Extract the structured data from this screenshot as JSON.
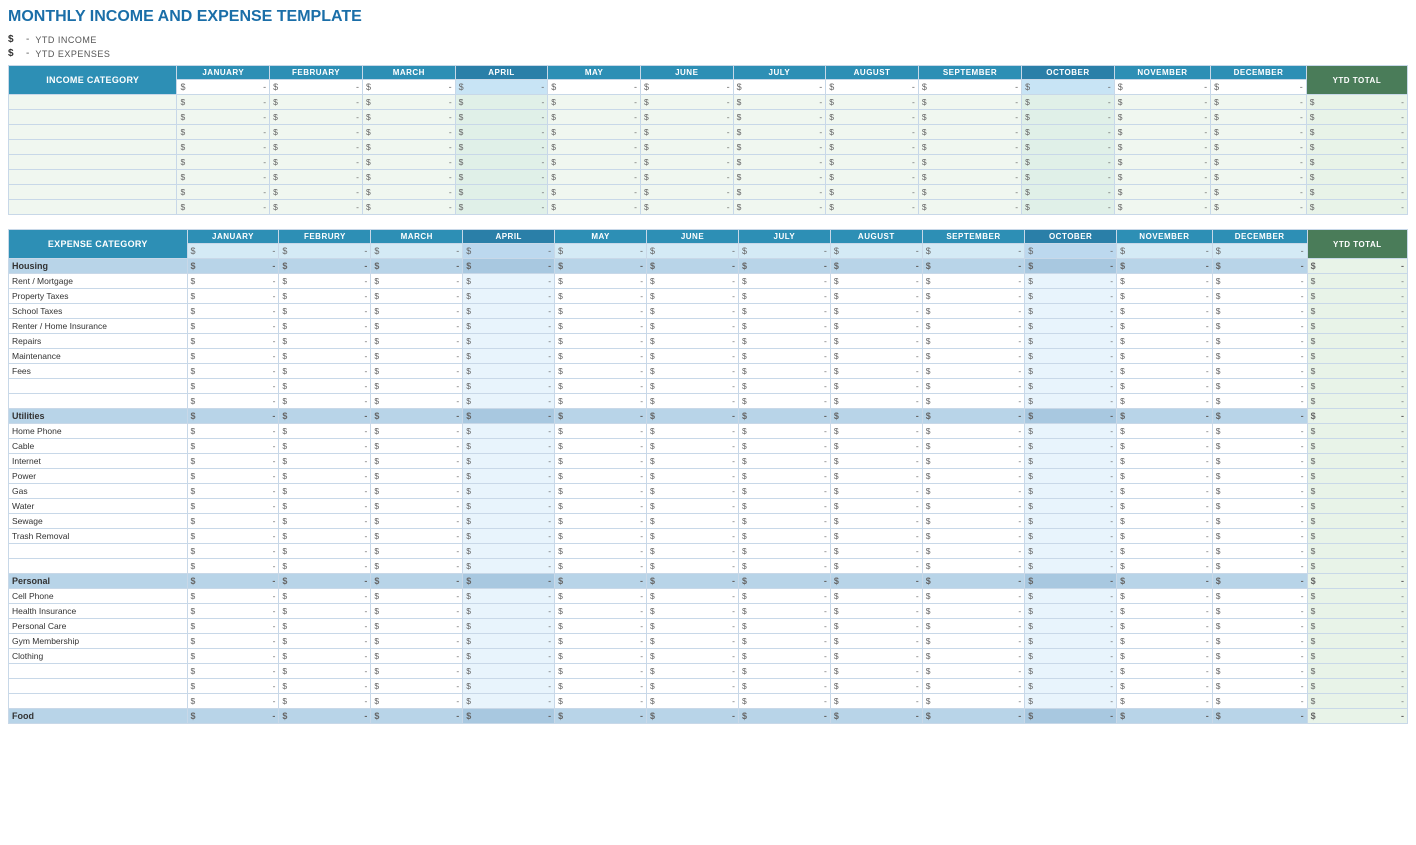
{
  "title": "MONTHLY INCOME AND EXPENSE TEMPLATE",
  "ytd": {
    "income_label": "YTD INCOME",
    "expense_label": "YTD EXPENSES",
    "dollar_sign": "$"
  },
  "income_table": {
    "category_header": "INCOME CATEGORY",
    "months": [
      "JANUARY",
      "FEBRUARY",
      "MARCH",
      "APRIL",
      "MAY",
      "JUNE",
      "JULY",
      "AUGUST",
      "SEPTEMBER",
      "OCTOBER",
      "NOVEMBER",
      "DECEMBER"
    ],
    "ytd_label": "YTD TOTAL",
    "rows": [
      {
        "cat": "",
        "vals": [
          "-",
          "-",
          "-",
          "-",
          "-",
          "-",
          "-",
          "-",
          "-",
          "-",
          "-",
          "-",
          "-"
        ]
      },
      {
        "cat": "",
        "vals": [
          "-",
          "-",
          "-",
          "-",
          "-",
          "-",
          "-",
          "-",
          "-",
          "-",
          "-",
          "-",
          "-"
        ]
      },
      {
        "cat": "",
        "vals": [
          "-",
          "-",
          "-",
          "-",
          "-",
          "-",
          "-",
          "-",
          "-",
          "-",
          "-",
          "-",
          "-"
        ]
      },
      {
        "cat": "",
        "vals": [
          "-",
          "-",
          "-",
          "-",
          "-",
          "-",
          "-",
          "-",
          "-",
          "-",
          "-",
          "-",
          "-"
        ]
      },
      {
        "cat": "",
        "vals": [
          "-",
          "-",
          "-",
          "-",
          "-",
          "-",
          "-",
          "-",
          "-",
          "-",
          "-",
          "-",
          "-"
        ]
      },
      {
        "cat": "",
        "vals": [
          "-",
          "-",
          "-",
          "-",
          "-",
          "-",
          "-",
          "-",
          "-",
          "-",
          "-",
          "-",
          "-"
        ]
      },
      {
        "cat": "",
        "vals": [
          "-",
          "-",
          "-",
          "-",
          "-",
          "-",
          "-",
          "-",
          "-",
          "-",
          "-",
          "-",
          "-"
        ]
      },
      {
        "cat": "",
        "vals": [
          "-",
          "-",
          "-",
          "-",
          "-",
          "-",
          "-",
          "-",
          "-",
          "-",
          "-",
          "-",
          "-"
        ]
      }
    ]
  },
  "expense_table": {
    "category_header": "EXPENSE CATEGORY",
    "months": [
      "JANUARY",
      "FEBRURY",
      "MARCH",
      "APRIL",
      "MAY",
      "JUNE",
      "JULY",
      "AUGUST",
      "SEPTEMBER",
      "OCTOBER",
      "NOVEMBER",
      "DECEMBER"
    ],
    "ytd_label": "YTD TOTAL",
    "sections": [
      {
        "name": "Housing",
        "rows": [
          {
            "cat": "Rent / Mortgage"
          },
          {
            "cat": "Property Taxes"
          },
          {
            "cat": "School Taxes"
          },
          {
            "cat": "Renter / Home Insurance"
          },
          {
            "cat": "Repairs"
          },
          {
            "cat": "Maintenance"
          },
          {
            "cat": "Fees"
          },
          {
            "cat": ""
          },
          {
            "cat": ""
          }
        ]
      },
      {
        "name": "Utilities",
        "rows": [
          {
            "cat": "Home Phone"
          },
          {
            "cat": "Cable"
          },
          {
            "cat": "Internet"
          },
          {
            "cat": "Power"
          },
          {
            "cat": "Gas"
          },
          {
            "cat": "Water"
          },
          {
            "cat": "Sewage"
          },
          {
            "cat": "Trash Removal"
          },
          {
            "cat": ""
          },
          {
            "cat": ""
          }
        ]
      },
      {
        "name": "Personal",
        "rows": [
          {
            "cat": "Cell Phone"
          },
          {
            "cat": "Health Insurance"
          },
          {
            "cat": "Personal Care"
          },
          {
            "cat": "Gym Membership"
          },
          {
            "cat": "Clothing"
          },
          {
            "cat": ""
          },
          {
            "cat": ""
          },
          {
            "cat": ""
          }
        ]
      },
      {
        "name": "Food",
        "rows": []
      }
    ]
  }
}
